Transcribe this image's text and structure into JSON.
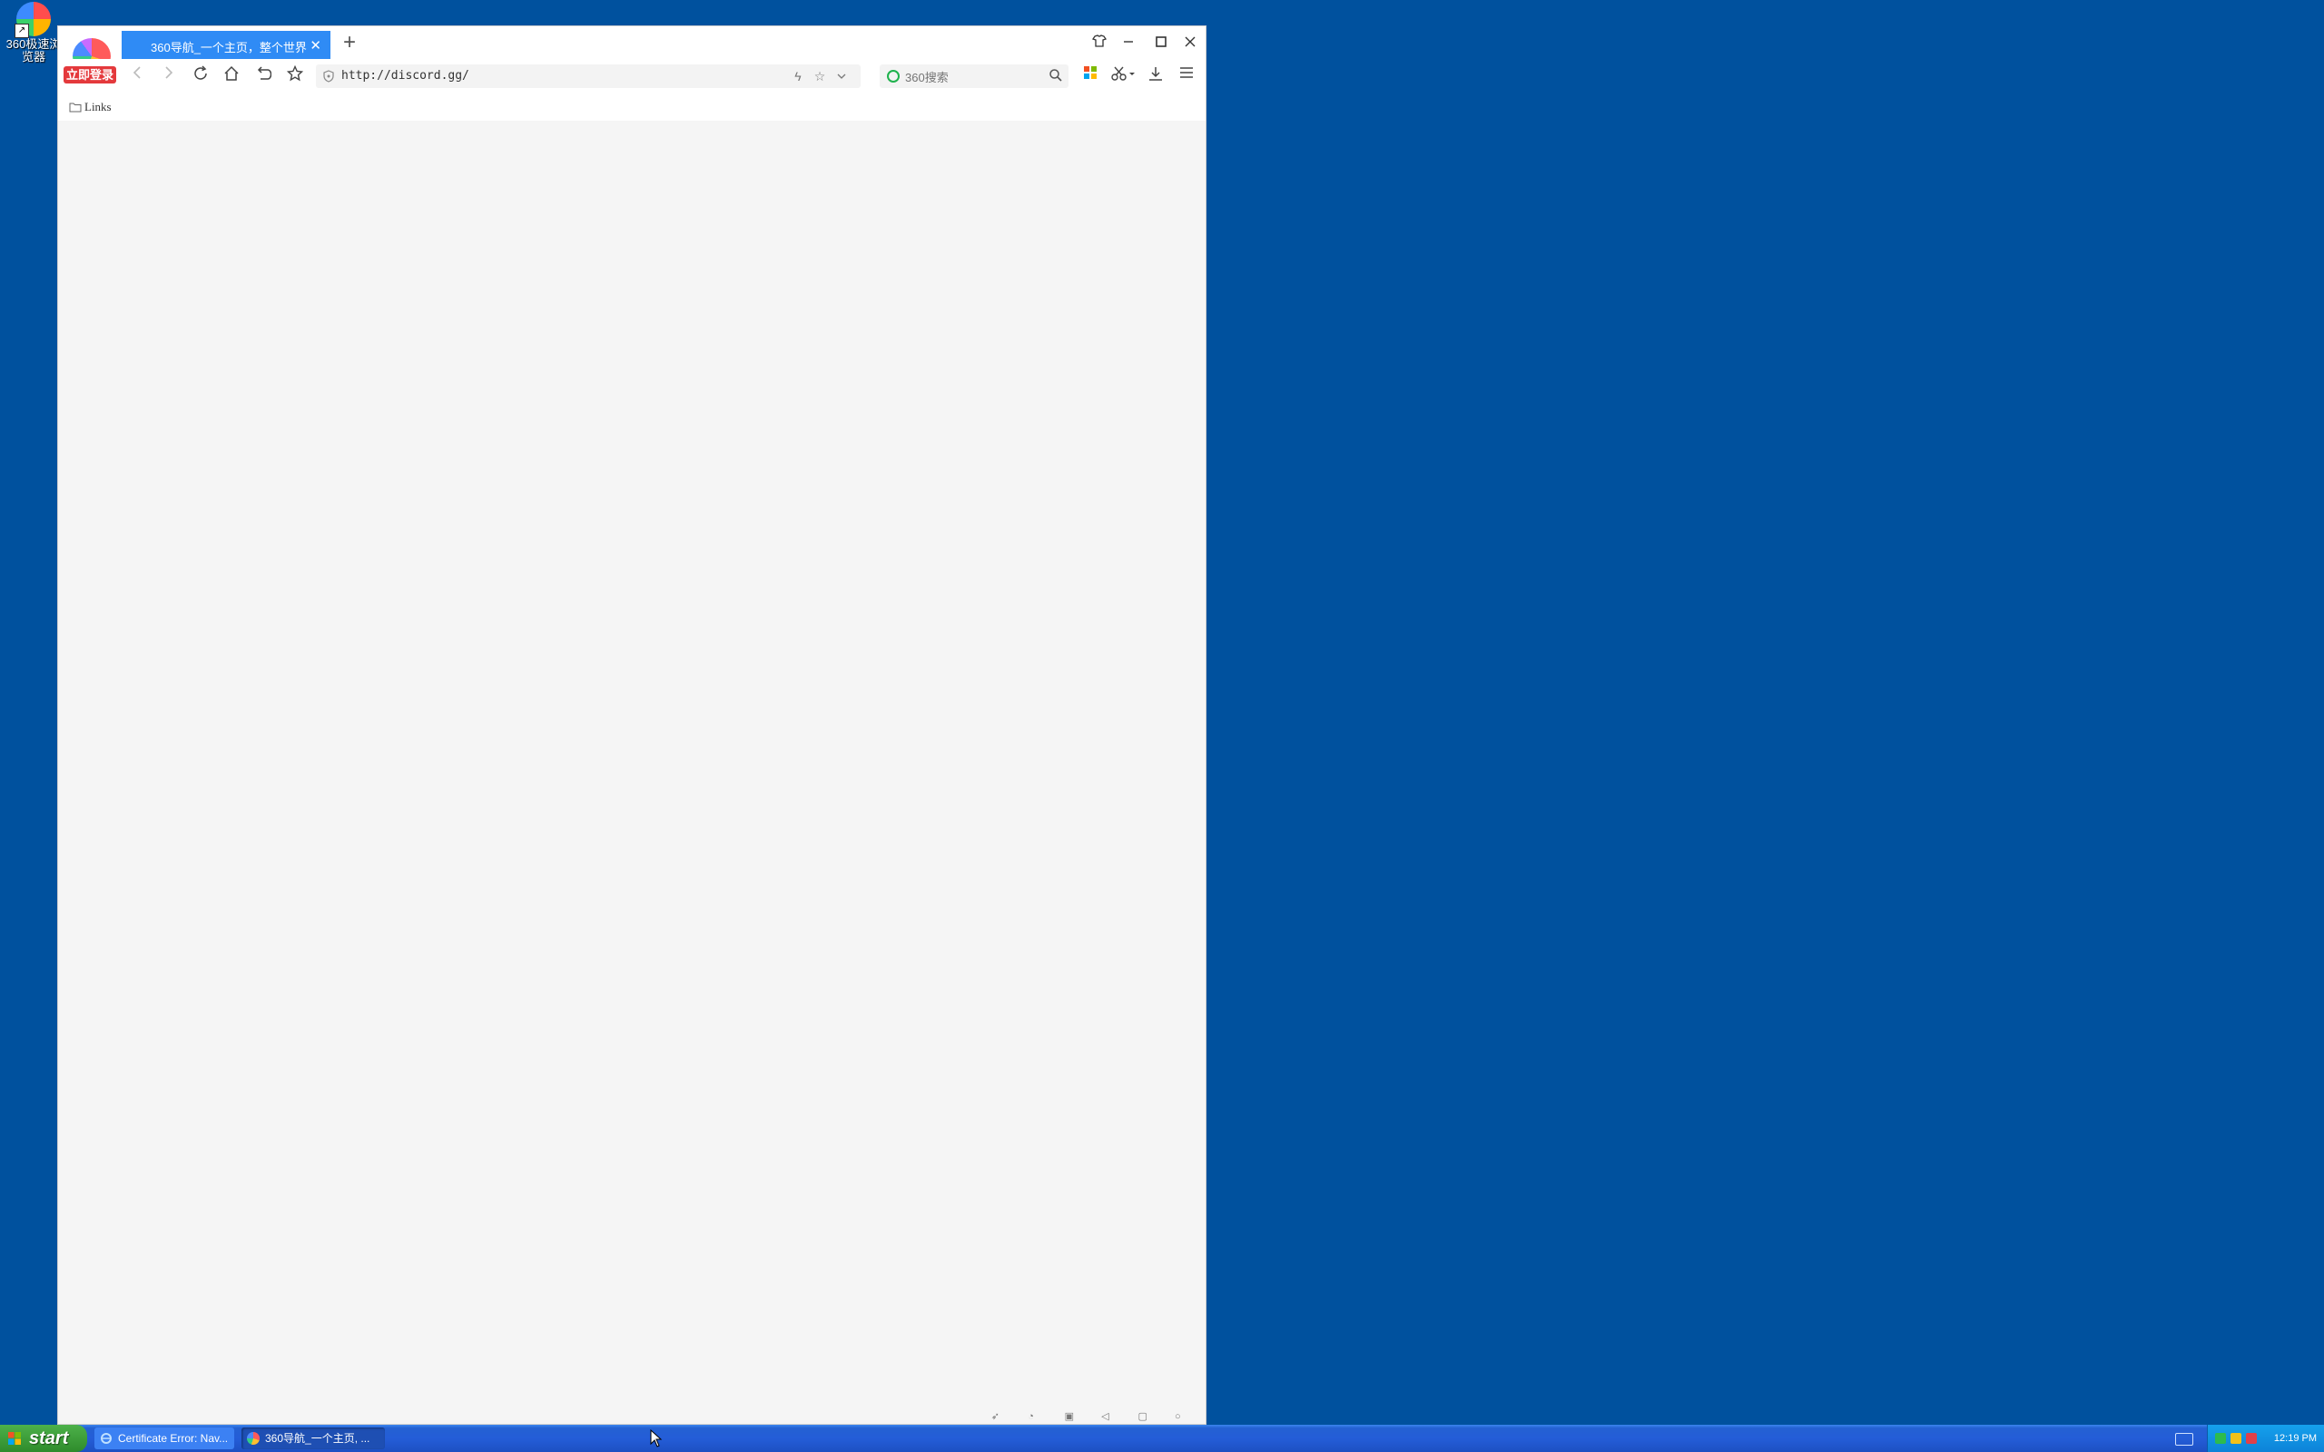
{
  "desktop": {
    "icon_label": "360极速浏览器"
  },
  "browser": {
    "login_badge": "立即登录",
    "tab_title": "360导航_一个主页，整个世界",
    "address_url": "http://discord.gg/",
    "search_placeholder": "360搜索",
    "bookmarks": [
      {
        "label": "Links"
      }
    ]
  },
  "taskbar": {
    "start_label": "start",
    "tasks": [
      {
        "label": "Certificate Error: Nav..."
      },
      {
        "label": "360导航_一个主页, ..."
      }
    ],
    "clock": "12:19 PM"
  }
}
